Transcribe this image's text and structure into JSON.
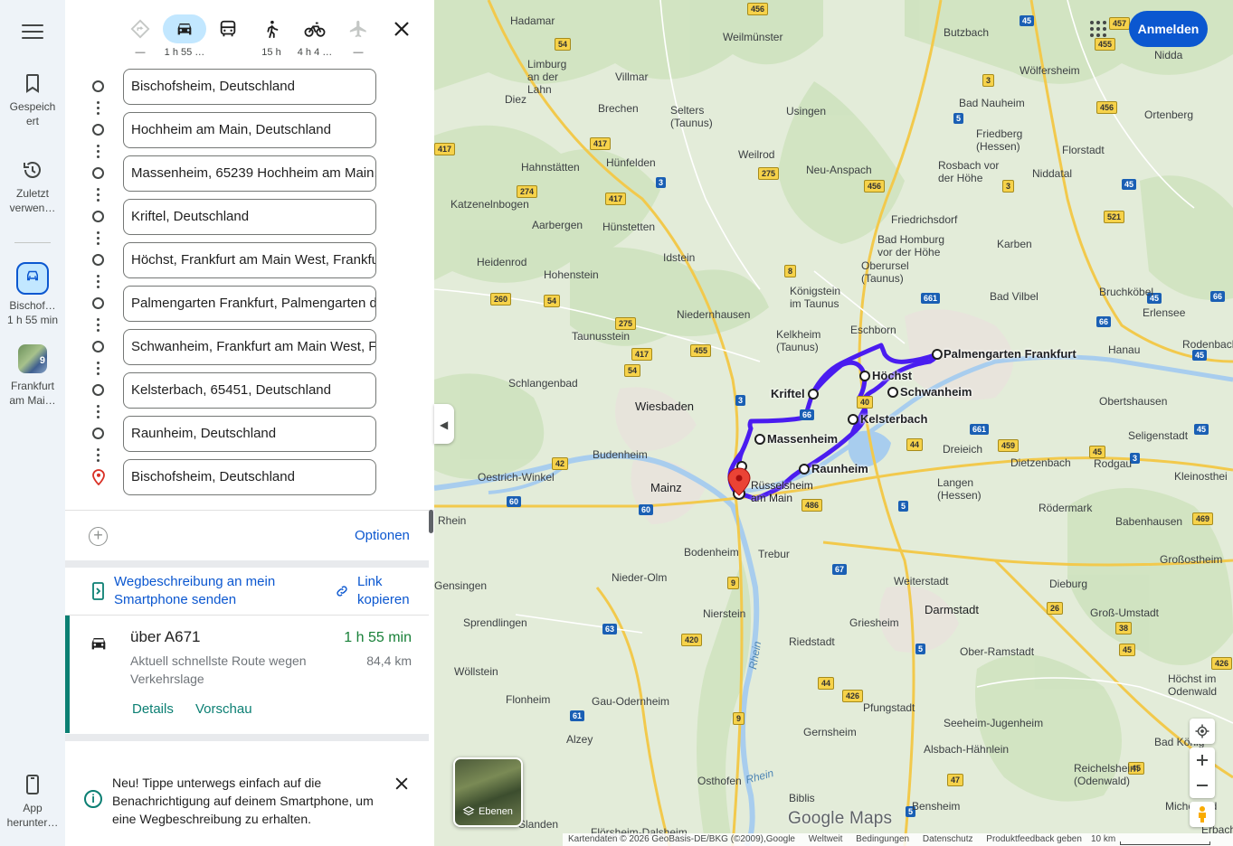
{
  "rail": {
    "saved_label": "Gespeich ert",
    "recent_label": "Zuletzt verwen…",
    "trip_label": "Bischof…",
    "trip_time": "1 h 55 min",
    "place_label": "Frankfurt am Mai…",
    "place_badge": "9",
    "app_label": "App herunter…"
  },
  "modes": {
    "best": "—",
    "car": "1 h 55 …",
    "transit": "",
    "walk": "15 h",
    "bike": "4 h 4 …",
    "flight": "—"
  },
  "stops": [
    "Bischofsheim, Deutschland",
    "Hochheim am Main, Deutschland",
    "Massenheim, 65239 Hochheim am Main,",
    "Kriftel, Deutschland",
    "Höchst, Frankfurt am Main West, Frankfu",
    "Palmengarten Frankfurt, Palmengarten d",
    "Schwanheim, Frankfurt am Main West, Fr",
    "Kelsterbach, 65451, Deutschland",
    "Raunheim, Deutschland",
    "Bischofsheim, Deutschland"
  ],
  "options_label": "Optionen",
  "send_label": "Wegbeschreibung an mein Smartphone senden",
  "copy_label": "Link kopieren",
  "route": {
    "title": "über A671",
    "description": "Aktuell schnellste Route wegen Verkehrslage",
    "time": "1 h 55 min",
    "distance": "84,4 km",
    "details_label": "Details",
    "preview_label": "Vorschau",
    "time_color": "#188038",
    "accent_color": "#0b7f73"
  },
  "notice": {
    "text": "Neu! Tippe unterwegs einfach auf die Benachrichtigung auf deinem Smartphone, um eine Wegbeschreibung zu erhalten."
  },
  "map": {
    "signin_label": "Anmelden",
    "layers_label": "Ebenen",
    "logo": "Google Maps",
    "route_color": "#4a1cf0",
    "places": {
      "palmengarten": "Palmengarten Frankfurt",
      "hoechst": "Höchst",
      "schwanheim": "Schwanheim",
      "kriftel": "Kriftel",
      "kelsterbach": "Kelsterbach",
      "massenheim": "Massenheim",
      "raunheim": "Raunheim",
      "ruesselsheim": "Rüsselsheim am Main"
    },
    "labels": {
      "hadamar": "Hadamar",
      "weilmuenster": "Weilmünster",
      "butzbach": "Butzbach",
      "limburg": "Limburg an der Lahn",
      "villmar": "Villmar",
      "woelfersheim": "Wölfersheim",
      "nidda": "Nidda",
      "diez": "Diez",
      "brechen": "Brechen",
      "selters": "Selters (Taunus)",
      "usingen": "Usingen",
      "badnauheim": "Bad Nauheim",
      "ortenberg": "Ortenberg",
      "friedberg": "Friedberg (Hessen)",
      "florstadt": "Florstadt",
      "weilrod": "Weilrod",
      "hahnstaetten": "Hahnstätten",
      "huenfelden": "Hünfelden",
      "neuanspach": "Neu-Anspach",
      "rosbach": "Rosbach vor der Höhe",
      "niddatal": "Niddatal",
      "katzenelnbogen": "Katzenelnbogen",
      "aarbergen": "Aarbergen",
      "huenstetten": "Hünstetten",
      "friedrichsdorf": "Friedrichsdorf",
      "heidenrod": "Heidenrod",
      "hohenstein": "Hohenstein",
      "idstein": "Idstein",
      "badhomburg": "Bad Homburg vor der Höhe",
      "karben": "Karben",
      "oberursel": "Oberursel (Taunus)",
      "koenigstein": "Königstein im Taunus",
      "bruchkoebel": "Bruchköbel",
      "niedernhausen": "Niedernhausen",
      "badvilbel": "Bad Vilbel",
      "erlensee": "Erlensee",
      "taunusstein": "Taunusstein",
      "eschborn": "Eschborn",
      "kelkheim": "Kelkheim (Taunus)",
      "hanau": "Hanau",
      "rodenbach": "Rodenbach",
      "schlangenbad": "Schlangenbad",
      "wiesbaden": "Wiesbaden",
      "offenthal": "Obertshausen",
      "budenheim": "Budenheim",
      "dreieich": "Dreieich",
      "dietzenbach": "Dietzenbach",
      "rodgau": "Rodgau",
      "seligenstadt": "Seligenstadt",
      "kleinostheim": "Kleinosthei",
      "oestrich": "Oestrich-Winkel",
      "mainz": "Mainz",
      "langen": "Langen (Hessen)",
      "roedermark": "Rödermark",
      "babenhausen": "Babenhausen",
      "rhein": "Rhein",
      "bodenheim": "Bodenheim",
      "trebur": "Trebur",
      "grossostheim": "Großostheim",
      "genheim": "Gensingen",
      "niederolm": "Nieder-Olm",
      "weiterstadt": "Weiterstadt",
      "dieburg": "Dieburg",
      "sprendlingen": "Sprendlingen",
      "nierstein": "Nierstein",
      "griesheim": "Griesheim",
      "darmstadt": "Darmstadt",
      "grossumstadt": "Groß-Umstadt",
      "woellstein": "Wöllstein",
      "riedstadt": "Riedstadt",
      "oberramstadt": "Ober-Ramstadt",
      "hoechstodw": "Höchst im Odenwald",
      "flonheim": "Flonheim",
      "gauodernheim": "Gau-Odernheim",
      "pfungstadt": "Pfungstadt",
      "seeheim": "Seeheim-Jugenheim",
      "badkoenig": "Bad König",
      "alzey": "Alzey",
      "gernsheim": "Gernsheim",
      "alsbach": "Alsbach-Hähnlein",
      "reichelsheim": "Reichelsheim (Odenwald)",
      "osthofen": "Osthofen",
      "bensheim": "Bensheim",
      "michelstadt": "Michelstad",
      "biblis": "Biblis",
      "erbach": "Erbach",
      "floersheim": "Flörsheim-Dalsheim",
      "slanden": "Slanden",
      "rhein2": "Rhein",
      "rhein3": "Rhein"
    }
  },
  "footer": {
    "copyright": "Kartendaten © 2026 GeoBasis-DE/BKG (©2009),Google",
    "weltweit": "Weltweit",
    "terms": "Bedingungen",
    "privacy": "Datenschutz",
    "feedback": "Produktfeedback geben",
    "scale": "10 km"
  }
}
